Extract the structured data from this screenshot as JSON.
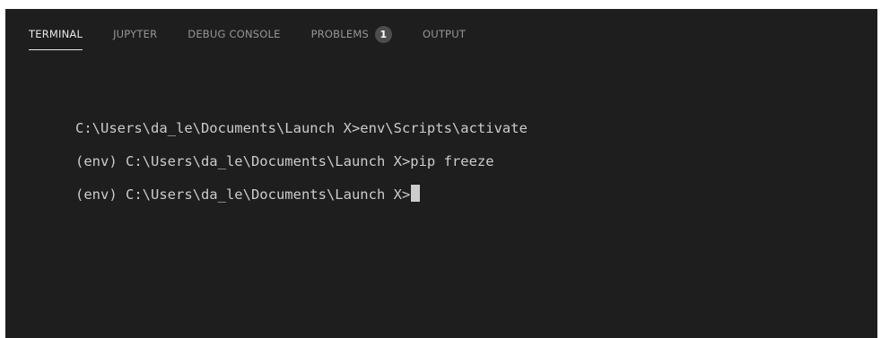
{
  "panel": {
    "tabs": [
      {
        "label": "TERMINAL",
        "active": true
      },
      {
        "label": "JUPYTER",
        "active": false
      },
      {
        "label": "DEBUG CONSOLE",
        "active": false
      },
      {
        "label": "PROBLEMS",
        "active": false,
        "badge": "1"
      },
      {
        "label": "OUTPUT",
        "active": false
      }
    ]
  },
  "terminal": {
    "lines": [
      "C:\\Users\\da_le\\Documents\\Launch X>env\\Scripts\\activate",
      "(env) C:\\Users\\da_le\\Documents\\Launch X>pip freeze",
      "(env) C:\\Users\\da_le\\Documents\\Launch X>"
    ]
  },
  "colors": {
    "background": "#1e1e1e",
    "text": "#cccccc",
    "tab_inactive": "#969696",
    "tab_active": "#e7e7e7",
    "badge_bg": "#4d4d4d"
  }
}
